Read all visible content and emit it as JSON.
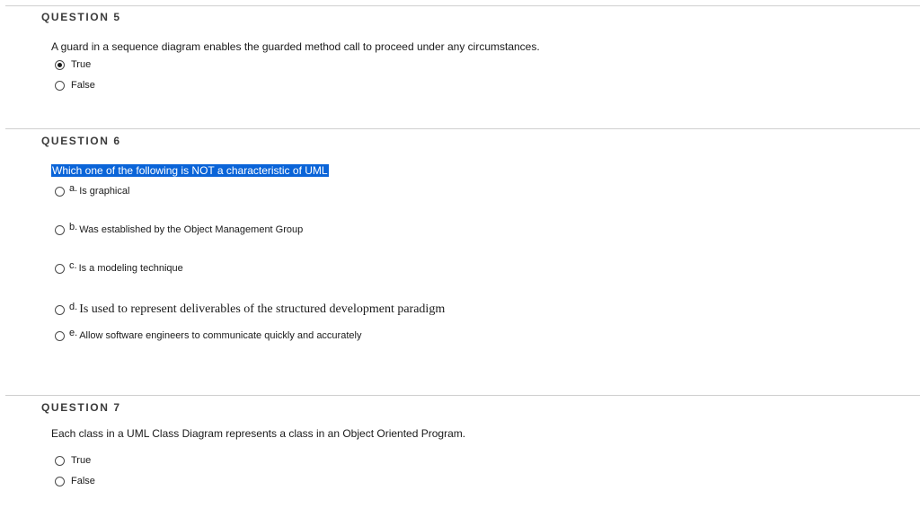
{
  "questions": [
    {
      "header": "QUESTION 5",
      "prompt": "A guard in a sequence diagram enables the guarded method call to proceed under any circumstances.",
      "options": [
        {
          "text": "True",
          "selected": true
        },
        {
          "text": "False",
          "selected": false
        }
      ]
    },
    {
      "header": "QUESTION 6",
      "prompt": "Which one of the following is NOT a characteristic of UML",
      "options": [
        {
          "letter": "a.",
          "text": "Is graphical",
          "selected": false
        },
        {
          "letter": "b.",
          "text": "Was established by the Object Management Group",
          "selected": false
        },
        {
          "letter": "c.",
          "text": "Is a modeling technique",
          "selected": false
        },
        {
          "letter": "d.",
          "text": "Is used to represent deliverables of the structured development paradigm",
          "selected": false
        },
        {
          "letter": "e.",
          "text": "Allow software engineers to communicate quickly and accurately",
          "selected": false
        }
      ]
    },
    {
      "header": "QUESTION 7",
      "prompt": "Each class in a UML Class Diagram represents a class in an Object Oriented Program.",
      "options": [
        {
          "text": "True",
          "selected": false
        },
        {
          "text": "False",
          "selected": false
        }
      ]
    }
  ]
}
